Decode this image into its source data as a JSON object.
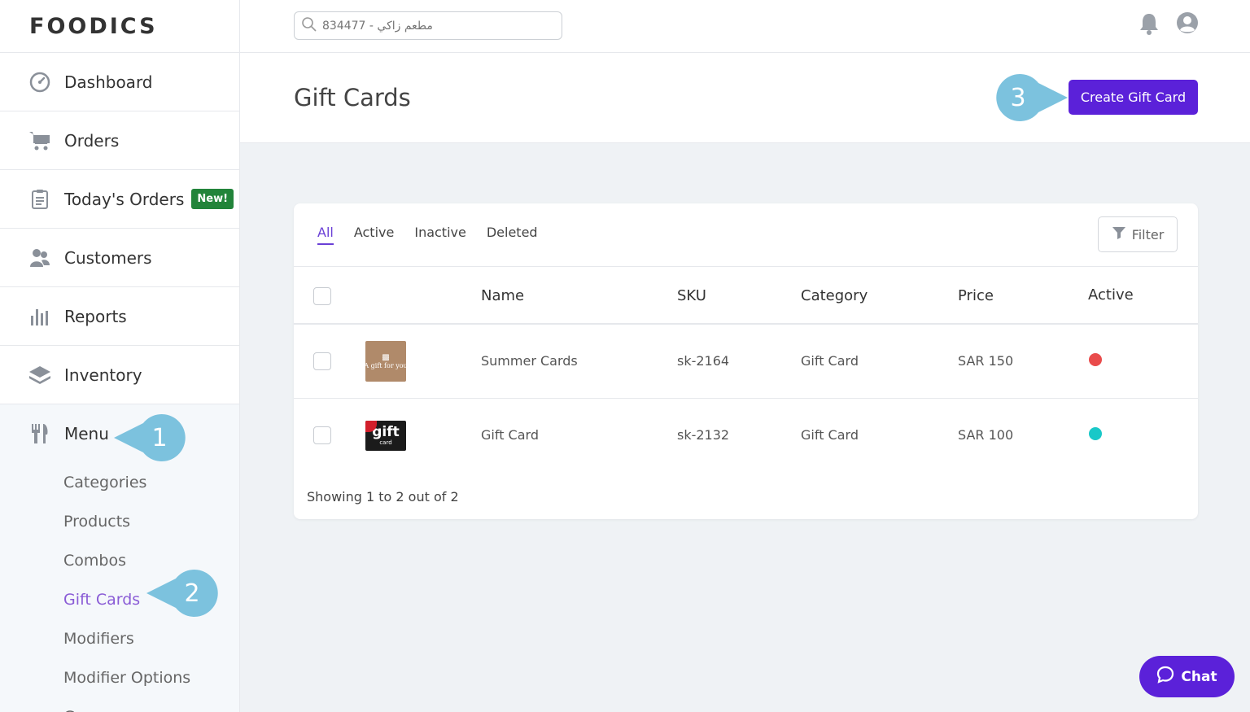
{
  "brand": {
    "logo": "FOODICS"
  },
  "search": {
    "placeholder": "834477 - مطعم زاكي"
  },
  "sidebar": {
    "items": [
      {
        "label": "Dashboard"
      },
      {
        "label": "Orders"
      },
      {
        "label": "Today's Orders",
        "badge": "New!"
      },
      {
        "label": "Customers"
      },
      {
        "label": "Reports"
      },
      {
        "label": "Inventory"
      }
    ],
    "menu": {
      "label": "Menu",
      "children": [
        "Categories",
        "Products",
        "Combos",
        "Gift Cards",
        "Modifiers",
        "Modifier Options",
        "Groups"
      ],
      "active": "Gift Cards"
    }
  },
  "page": {
    "title": "Gift Cards",
    "create_label": "Create Gift Card"
  },
  "tabs": [
    "All",
    "Active",
    "Inactive",
    "Deleted"
  ],
  "active_tab": "All",
  "filter_label": "Filter",
  "table": {
    "columns": [
      "Name",
      "SKU",
      "Category",
      "Price",
      "Active"
    ],
    "rows": [
      {
        "thumb_text": "A gift for you",
        "name": "Summer Cards",
        "sku": "sk-2164",
        "category": "Gift Card",
        "price": "SAR 150",
        "active": false
      },
      {
        "thumb_text": "gift",
        "thumb_subtext": "card",
        "name": "Gift Card",
        "sku": "sk-2132",
        "category": "Gift Card",
        "price": "SAR 100",
        "active": true
      }
    ]
  },
  "footer": {
    "showing": "Showing 1 to 2 out of 2"
  },
  "chat": {
    "label": "Chat"
  },
  "annotations": [
    "1",
    "2",
    "3"
  ],
  "colors": {
    "accent": "#5b21d9",
    "active_dot": "#19c8c8",
    "inactive_dot": "#e94b4b",
    "callout": "#7cc2de",
    "new_badge": "#22843a"
  }
}
